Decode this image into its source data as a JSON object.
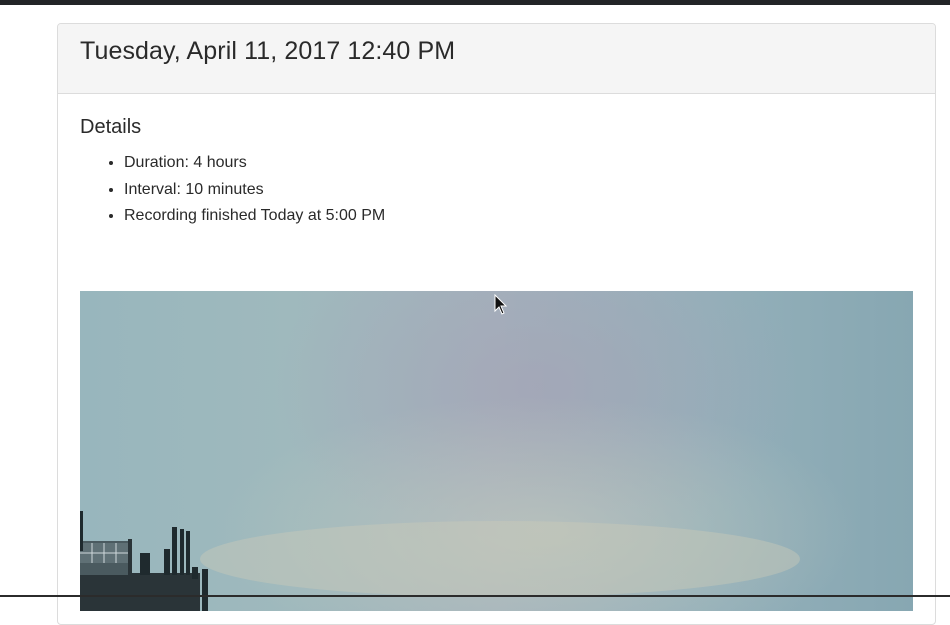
{
  "header": {
    "datetime": "Tuesday, April 11, 2017 12:40 PM"
  },
  "details": {
    "title": "Details",
    "items": [
      "Duration: 4 hours",
      "Interval: 10 minutes",
      "Recording finished Today at 5:00 PM"
    ]
  },
  "photo": {
    "description_icon": "sky-photo-image"
  }
}
